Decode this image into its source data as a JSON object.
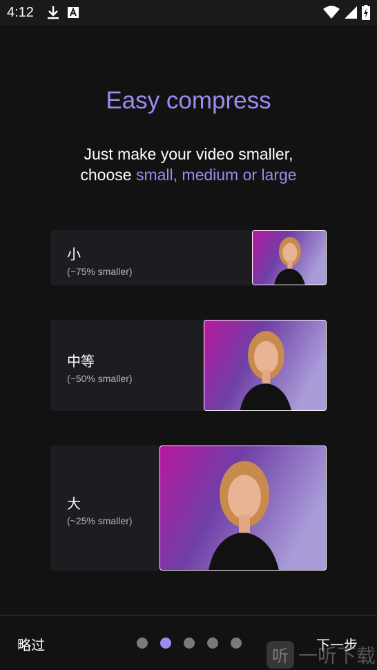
{
  "status_bar": {
    "time": "4:12",
    "icons_left": [
      "download-icon",
      "font-a-icon"
    ],
    "icons_right": [
      "wifi-icon",
      "signal-icon",
      "battery-charging-icon"
    ]
  },
  "onboarding": {
    "title": "Easy compress",
    "subtitle_line1": "Just make your video smaller,",
    "subtitle_prefix": "choose ",
    "subtitle_accent": "small, medium or large"
  },
  "options": [
    {
      "name": "小",
      "desc": "(~75% smaller)"
    },
    {
      "name": "中等",
      "desc": "(~50% smaller)"
    },
    {
      "name": "大",
      "desc": "(~25% smaller)"
    }
  ],
  "navigation": {
    "skip_label": "略过",
    "next_label": "下一步",
    "page_count": 5,
    "current_page": 2
  },
  "watermark": {
    "icon_char": "听",
    "text": "一听下载"
  },
  "colors": {
    "background": "#121212",
    "accent": "#9b8cf0",
    "card": "#1d1d21",
    "dot_inactive": "#7a7a7e"
  }
}
